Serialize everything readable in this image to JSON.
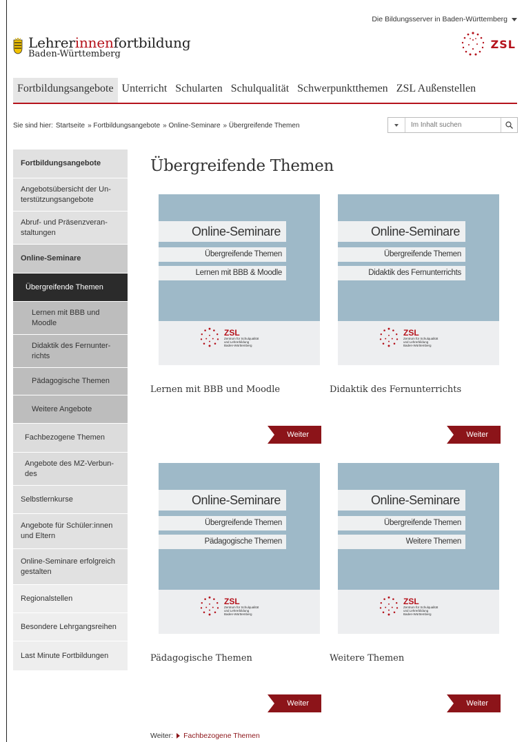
{
  "topbar": {
    "servers_label": "Die Bildungsserver in Baden-Württemberg"
  },
  "logo": {
    "title_part1": "Lehrer",
    "title_part2": "innen",
    "title_part3": "fortbildung",
    "subtitle": "Baden-Württemberg",
    "zsl_label": "ZSL"
  },
  "nav": {
    "items": [
      "Fortbildungsangebote",
      "Unterricht",
      "Schularten",
      "Schulqualität",
      "Schwerpunktthemen",
      "ZSL Außenstellen"
    ],
    "active_index": 0
  },
  "breadcrumb": {
    "prefix": "Sie sind hier:",
    "items": [
      "Startseite",
      "» Fortbildungsangebote",
      "» Online-Seminare",
      "» Übergreifende Themen"
    ]
  },
  "search": {
    "placeholder": "Im Inhalt suchen"
  },
  "sidebar": {
    "items": [
      "Fortbildungsangebote",
      "Angebotsübersicht der Un-terstützungsangebote",
      "Abruf- und Präsenzveran-staltungen",
      "Online-Seminare",
      "Übergreifende Themen",
      "Lernen mit BBB und Moodle",
      "Didaktik des Fernunter-richts",
      "Pädagogische Themen",
      "Weitere Angebote",
      "Fachbezogene Themen",
      "Angebote des MZ-Verbun-des",
      "Selbstlernkurse",
      "Angebote für Schüler:innen und Eltern",
      "Online-Seminare erfolgreich gestalten",
      "Regionalstellen",
      "Besondere Lehrgangsreihen",
      "Last Minute Fortbildungen"
    ]
  },
  "main": {
    "title": "Übergreifende Themen",
    "cards": [
      {
        "banner": "Online-Seminare",
        "line1": "Übergreifende Themen",
        "line2": "Lernen mit BBB & Moodle",
        "title": "Lernen mit BBB und Moodle",
        "button": "Weiter"
      },
      {
        "banner": "Online-Seminare",
        "line1": "Übergreifende Themen",
        "line2": "Didaktik des Fernunterrichts",
        "title": "Didaktik des Fernunterrichts",
        "button": "Weiter"
      },
      {
        "banner": "Online-Seminare",
        "line1": "Übergreifende Themen",
        "line2": "Pädagogische Themen",
        "title": "Pädagogische Themen",
        "button": "Weiter"
      },
      {
        "banner": "Online-Seminare",
        "line1": "Übergreifende Themen",
        "line2": "Weitere Themen",
        "title": "Weitere Themen",
        "button": "Weiter"
      }
    ],
    "thumb_logo": {
      "name": "ZSL",
      "line1": "Zentrum für Schulqualität",
      "line2": "und Lehrerbildung",
      "line3": "Baden-Württemberg"
    },
    "next": {
      "prefix": "Weiter:",
      "link": "Fachbezogene Themen"
    }
  },
  "colors": {
    "brand_red": "#b5121b",
    "button_red": "#8c1419",
    "thumb_blue": "#9eb9c8",
    "sidebar_current": "#2b2b2b"
  }
}
